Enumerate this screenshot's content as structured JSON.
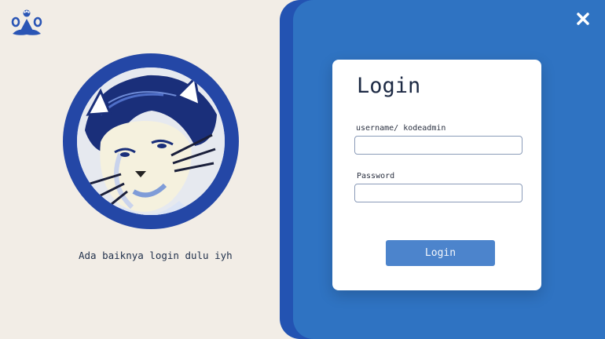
{
  "brand": {
    "logo_icon": "paw-logo-icon"
  },
  "profile": {
    "avatar_icon": "cat-boy-avatar",
    "tagline": "Ada baiknya login dulu iyh"
  },
  "panel": {
    "close_icon": "close-icon"
  },
  "login": {
    "title": "Login",
    "username_label": "username/ kodeadmin",
    "username_value": "",
    "username_placeholder": "",
    "password_label": "Password",
    "password_value": "",
    "password_placeholder": "",
    "submit_label": "Login"
  },
  "colors": {
    "background": "#f2ede6",
    "panel": "#2f73c2",
    "panel_edge": "#2353b2",
    "button": "#4c84cc",
    "avatar_ring": "#2447a6"
  }
}
